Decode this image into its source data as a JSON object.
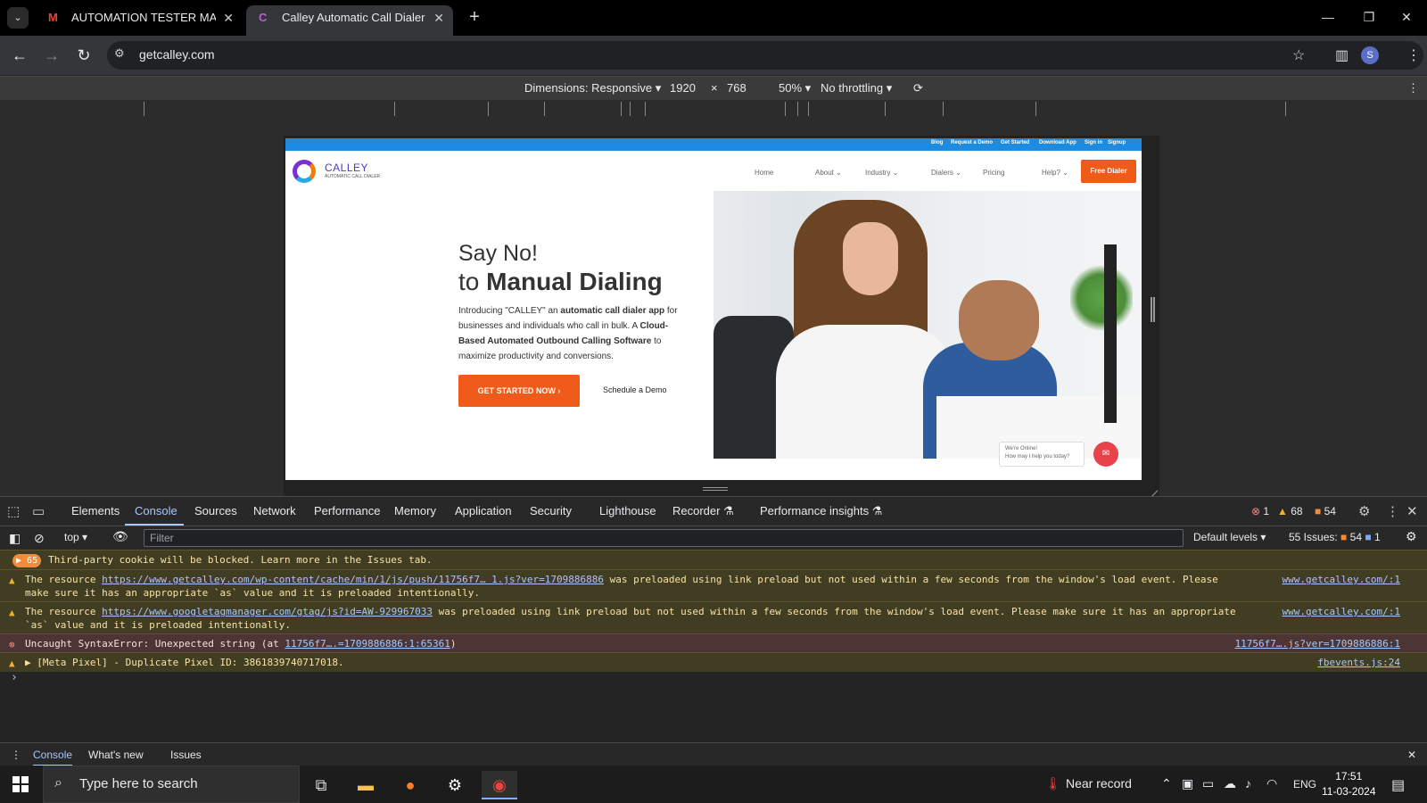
{
  "browser": {
    "tabs": [
      {
        "title": "AUTOMATION TESTER MACHIN",
        "favicon": "gmail-icon"
      },
      {
        "title": "Calley Automatic Call Dialer For",
        "favicon": "calley-icon"
      }
    ],
    "url": "getcalley.com",
    "profile_initial": "S"
  },
  "device_toolbar": {
    "dimensions_label": "Dimensions: Responsive",
    "width": "1920",
    "times": "×",
    "height": "768",
    "zoom": "50%",
    "throttling": "No throttling"
  },
  "site": {
    "topbar_links": [
      "Blog",
      "Request a Demo",
      "Get Started",
      "Download App",
      "Sign in",
      "Signup"
    ],
    "logo_text": "CALLEY",
    "logo_sub": "AUTOMATIC CALL DIALER",
    "menu": [
      "Home",
      "About",
      "Industry",
      "Dialers",
      "Pricing",
      "Help?"
    ],
    "free_button": "Free Dialer",
    "hero_line1": "Say No!",
    "hero_line2_prefix": "to",
    "hero_line2_bold": "Manual Dialing",
    "hero_p": {
      "t1": "Introducing \"CALLEY\" an ",
      "b1": "automatic call dialer app",
      "t2": " for businesses and individuals who call in bulk. A ",
      "b2": "Cloud-Based Automated Outbound Calling Software",
      "t3": " to maximize productivity and conversions."
    },
    "cta": "GET STARTED NOW",
    "demo_link": "Schedule a Demo",
    "chat_line1": "We're Online!",
    "chat_line2": "How may I help you today?"
  },
  "devtools": {
    "tabs": [
      "Elements",
      "Console",
      "Sources",
      "Network",
      "Performance",
      "Memory",
      "Application",
      "Security",
      "Lighthouse",
      "Recorder",
      "Performance insights"
    ],
    "active_tab": "Console",
    "errors": "1",
    "warnings": "68",
    "infos": "54",
    "context": "top",
    "filter_placeholder": "Filter",
    "levels": "Default levels",
    "issues_label": "55 Issues:",
    "issues_warn": "54",
    "issues_info": "1"
  },
  "console": {
    "cookie_count": "65",
    "cookie_msg": "Third-party cookie will be blocked. Learn more in the Issues tab.",
    "m1_pre": "The resource ",
    "m1_link": "https://www.getcalley.com/wp-content/cache/min/1/js/push/11756f7… 1.js?ver=1709886886",
    "m1_post": " was preloaded using link preload but not used within a few seconds from the window's load event. Please make sure it has an appropriate `as` value and it is preloaded intentionally.",
    "m1_src": "www.getcalley.com/:1",
    "m2_pre": "The resource ",
    "m2_link": "https://www.googletagmanager.com/gtag/js?id=AW-929967033",
    "m2_post": " was preloaded using link preload but not used within a few seconds from the window's load event. Please make sure it has an appropriate `as` value and it is preloaded intentionally.",
    "m2_src": "www.getcalley.com/:1",
    "m3_pre": "Uncaught SyntaxError: Unexpected string (at ",
    "m3_link": "11756f7….=1709886886:1:65361",
    "m3_post": ")",
    "m3_src": "11756f7….js?ver=1709886886:1",
    "m4_text": "[Meta Pixel] - Duplicate Pixel ID: 3861839740717018.",
    "m4_src": "fbevents.js:24"
  },
  "drawer": {
    "tabs": [
      "Console",
      "What's new",
      "Issues"
    ]
  },
  "taskbar": {
    "search_placeholder": "Type here to search",
    "weather": "Near record",
    "lang": "ENG",
    "time": "17:51",
    "date": "11-03-2024"
  }
}
